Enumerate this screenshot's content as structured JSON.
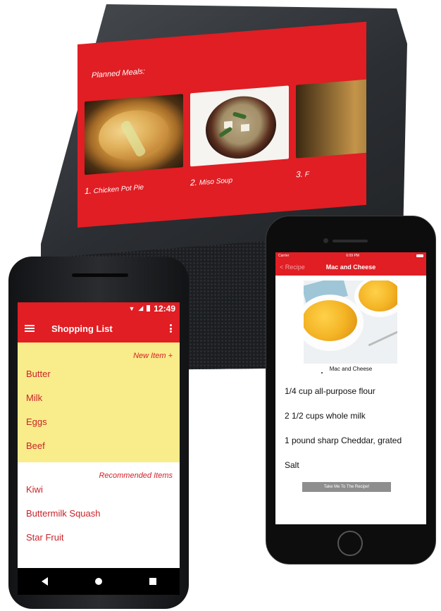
{
  "echo": {
    "title": "Planned Meals:",
    "meals": [
      {
        "number": "1.",
        "name": "Chicken Pot Pie"
      },
      {
        "number": "2.",
        "name": "Miso Soup"
      },
      {
        "number": "3.",
        "name": "F"
      }
    ]
  },
  "android": {
    "status_time": "12:49",
    "title": "Shopping List",
    "new_item_label": "New Item +",
    "items": [
      "Butter",
      "Milk",
      "Eggs",
      "Beef"
    ],
    "recommended_label": "Recommended Items",
    "recommended": [
      "Kiwi",
      "Buttermilk Squash",
      "Star Fruit"
    ]
  },
  "iphone": {
    "carrier": "Carrier",
    "time": "6:09 PM",
    "back_label": "< Recipe",
    "title": "Mac and Cheese",
    "caption": "Mac and Cheese",
    "ingredients": [
      "1/4 cup all-purpose flour",
      "2 1/2 cups whole milk",
      "1 pound sharp Cheddar, grated",
      "Salt"
    ],
    "button_label": "Take Me To The Recipe!"
  },
  "colors": {
    "accent_red": "#e01e24",
    "highlight_yellow": "#f9ec8a"
  }
}
